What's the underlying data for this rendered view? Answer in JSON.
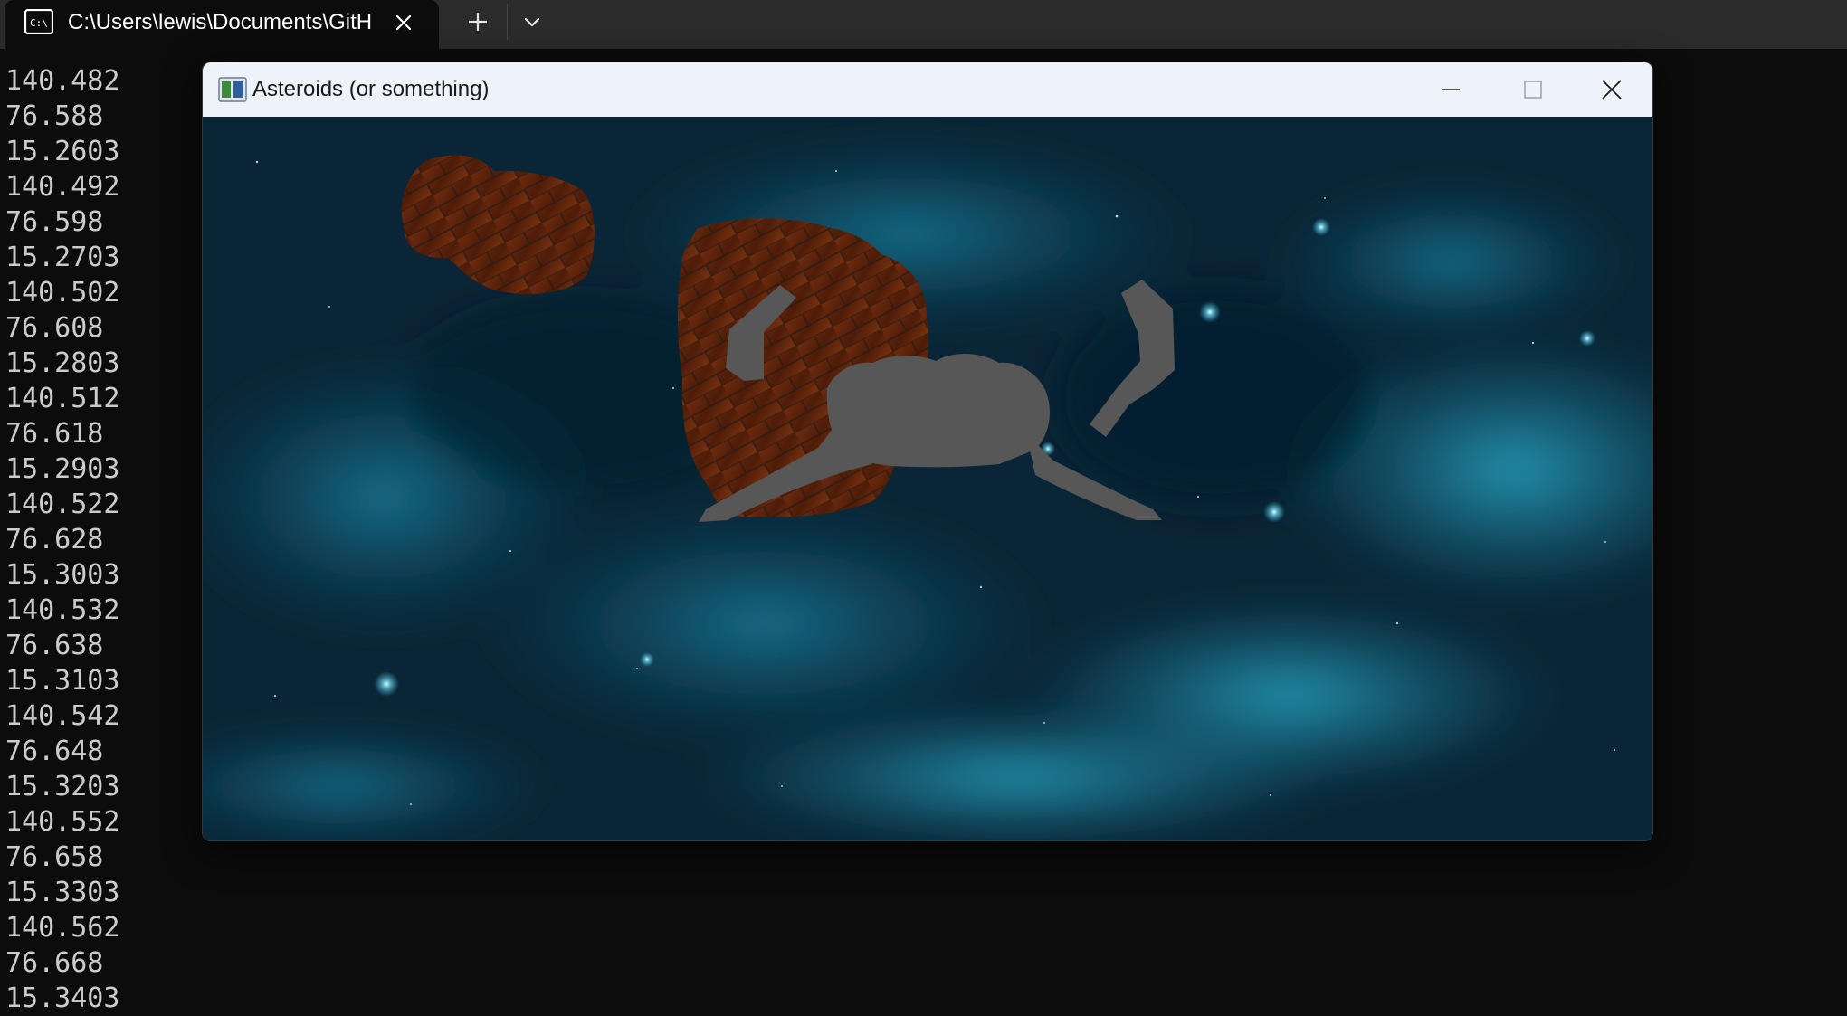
{
  "terminal": {
    "tab": {
      "title": "C:\\Users\\lewis\\Documents\\GitHub",
      "icon": "terminal-icon"
    },
    "new_tab_icon": "plus-icon",
    "dropdown_icon": "chevron-down-icon",
    "output_lines": [
      "140.482",
      "76.588",
      "15.2603",
      "140.492",
      "76.598",
      "15.2703",
      "140.502",
      "76.608",
      "15.2803",
      "140.512",
      "76.618",
      "15.2903",
      "140.522",
      "76.628",
      "15.3003",
      "140.532",
      "76.638",
      "15.3103",
      "140.542",
      "76.648",
      "15.3203",
      "140.552",
      "76.658",
      "15.3303",
      "140.562",
      "76.668",
      "15.3403"
    ]
  },
  "game_window": {
    "title": "Asteroids (or something)",
    "icon": "app-window-icon",
    "controls": {
      "minimize": "minimize-icon",
      "maximize": "maximize-icon",
      "close": "close-icon"
    },
    "scene": {
      "background": "nebula starfield",
      "objects": [
        "asteroid",
        "asteroid",
        "spaceship"
      ]
    }
  },
  "colors": {
    "terminal_bg": "#0c0c0c",
    "terminal_text": "#cccccc",
    "tabbar_bg": "#2b2b2b",
    "titlebar_bg": "#eef3f9",
    "nebula": "#1fa6c9",
    "asteroid": "#6b2a10",
    "ship": "#5a5a5a"
  }
}
